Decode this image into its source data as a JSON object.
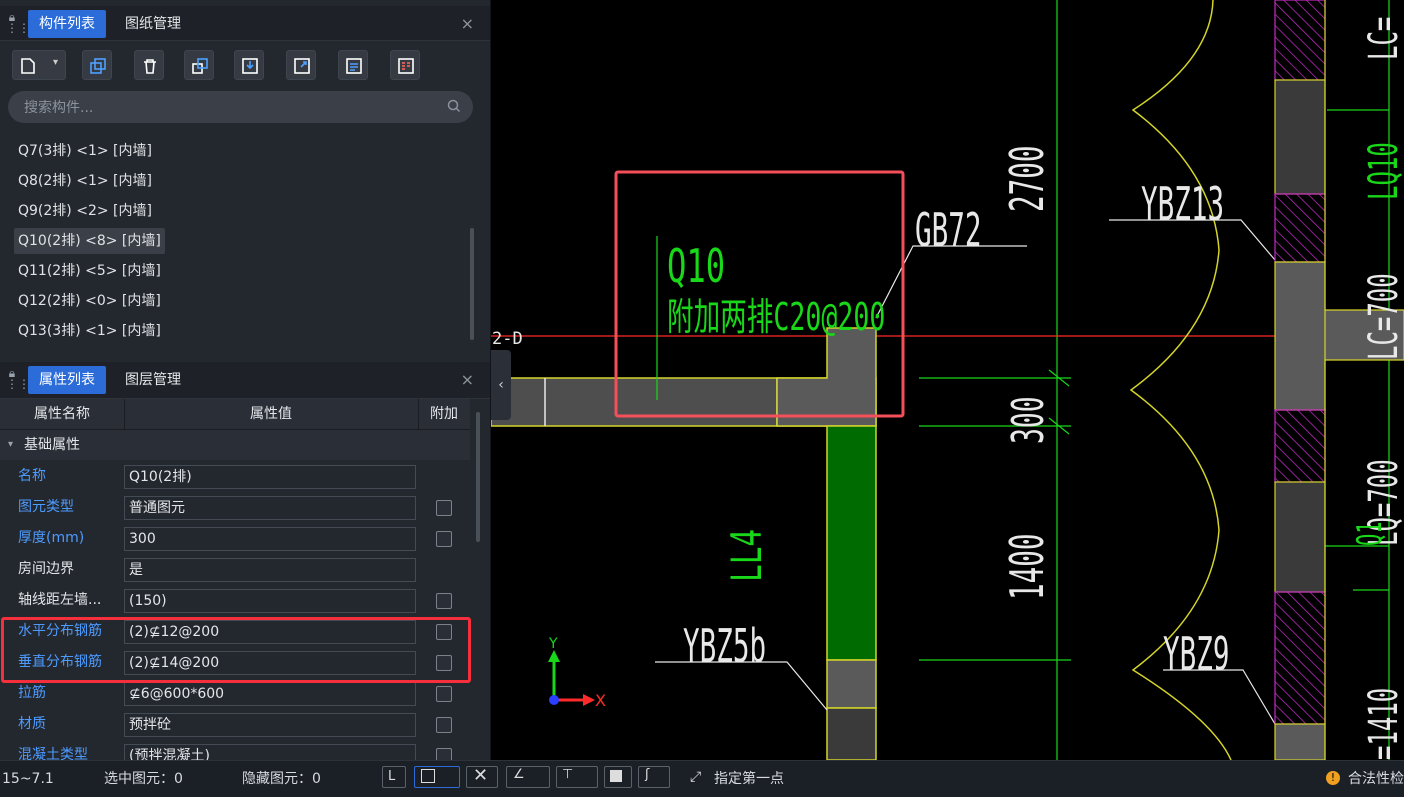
{
  "top_panel": {
    "tabs": [
      {
        "label": "构件列表",
        "active": true
      },
      {
        "label": "图纸管理",
        "active": false
      }
    ],
    "close": "×"
  },
  "search": {
    "placeholder": "搜索构件..."
  },
  "components": [
    {
      "label": "Q7(3排) <1> [内墙]"
    },
    {
      "label": "Q8(2排) <1> [内墙]"
    },
    {
      "label": "Q9(2排) <2> [内墙]"
    },
    {
      "label": "Q10(2排) <8> [内墙]",
      "selected": true
    },
    {
      "label": "Q11(2排) <5> [内墙]"
    },
    {
      "label": "Q12(2排) <0> [内墙]"
    },
    {
      "label": "Q13(3排) <1> [内墙]"
    }
  ],
  "bottom_panel": {
    "tabs": [
      {
        "label": "属性列表",
        "active": true
      },
      {
        "label": "图层管理",
        "active": false
      }
    ],
    "close": "×"
  },
  "props": {
    "headers": {
      "name": "属性名称",
      "value": "属性值",
      "extra": "附加"
    },
    "group": "基础属性",
    "rows": [
      {
        "name": "名称",
        "value": "Q10(2排)",
        "blue": true,
        "check": false
      },
      {
        "name": "图元类型",
        "value": "普通图元",
        "blue": true,
        "check": true
      },
      {
        "name": "厚度(mm)",
        "value": "300",
        "blue": true,
        "check": true
      },
      {
        "name": "房间边界",
        "value": "是",
        "blue": false,
        "check": false
      },
      {
        "name": "轴线距左墙...",
        "value": "(150)",
        "blue": false,
        "check": true
      },
      {
        "name": "水平分布钢筋",
        "value": "(2)⊈12@200",
        "blue": true,
        "check": true
      },
      {
        "name": "垂直分布钢筋",
        "value": "(2)⊈14@200",
        "blue": true,
        "check": true
      },
      {
        "name": "拉筋",
        "value": "⊈6@600*600",
        "blue": true,
        "check": true
      },
      {
        "name": "材质",
        "value": "预拌砼",
        "blue": true,
        "check": true
      },
      {
        "name": "混凝土类型",
        "value": "(预拌混凝土)",
        "blue": true,
        "check": true
      }
    ]
  },
  "drawing": {
    "labels": {
      "axis": "2-D",
      "wall": "Q10",
      "wall_note": "附加两排C20@200",
      "gb": "GB72",
      "ybz13": "YBZ13",
      "ybz5b": "YBZ5b",
      "ybz9": "YBZ9",
      "ll4": "LL4",
      "lc": "LC=",
      "q10_right": "LQ10",
      "lc700a": "LC=700",
      "lc700b": "LQ=700",
      "lq": "Q1",
      "dim_2700": "2700",
      "dim_300": "300",
      "dim_1400": "1400",
      "dim_1410": "=1410",
      "y": "Y",
      "x": "X"
    },
    "colors": {
      "green": "#19d719",
      "yellow": "#d4d42a",
      "magenta": "#c42bc4",
      "red": "#ff2a2a",
      "white": "#e8e8e8",
      "gray": "#5a5a5a",
      "dkgreen": "#006b00"
    }
  },
  "status": {
    "coord": "15~7.1",
    "selected": "选中图元：0",
    "hidden": "隐藏图元：0",
    "prompt": "指定第一点",
    "check": "合法性检"
  }
}
